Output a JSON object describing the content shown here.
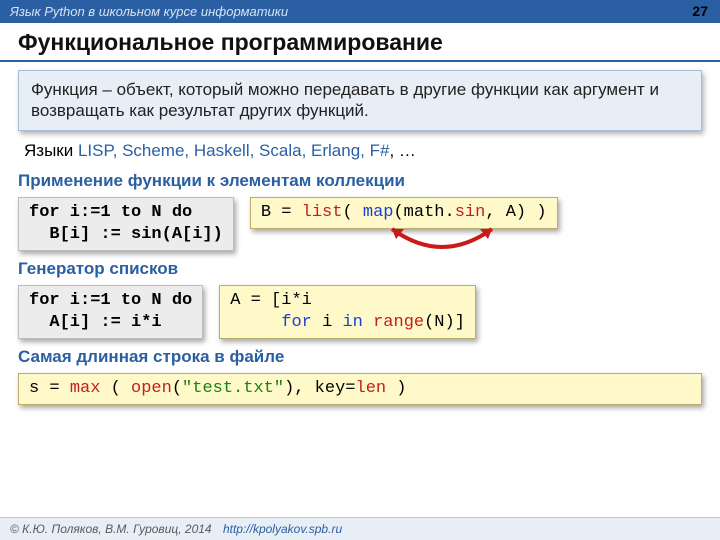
{
  "header": {
    "course": "Язык Python в школьном курсе информатики",
    "page": "27"
  },
  "title": "Функциональное программирование",
  "definition": "Функция – объект, который можно передавать в другие функции как аргумент и возвращать как результат других функций.",
  "langs": {
    "prefix": "Языки ",
    "list": "LISP, Scheme, Haskell, Scala, Erlang, F#",
    "suffix": ", …"
  },
  "sect1": {
    "head": "Применение функции к элементам коллекции",
    "grey": "for i:=1 to N do\n  B[i] := sin(A[i])",
    "yellow_parts": [
      "B = ",
      "list",
      "( ",
      "map",
      "(math.",
      "sin",
      ", A) )"
    ]
  },
  "sect2": {
    "head": "Генератор списков",
    "grey": "for i:=1 to N do\n  A[i] := i*i",
    "yellow_parts": [
      "A = [i*i\n     ",
      "for",
      " i ",
      "in",
      " ",
      "range",
      "(N)]"
    ]
  },
  "sect3": {
    "head": "Самая длинная строка в файле",
    "yellow_parts": [
      "s = ",
      "max",
      " ( ",
      "open",
      "(",
      "\"test.txt\"",
      "), key=",
      "len",
      " )"
    ]
  },
  "footer": {
    "copy": "© К.Ю. Поляков, В.М. Гуровиц, 2014",
    "url": "http://kpolyakov.spb.ru"
  }
}
